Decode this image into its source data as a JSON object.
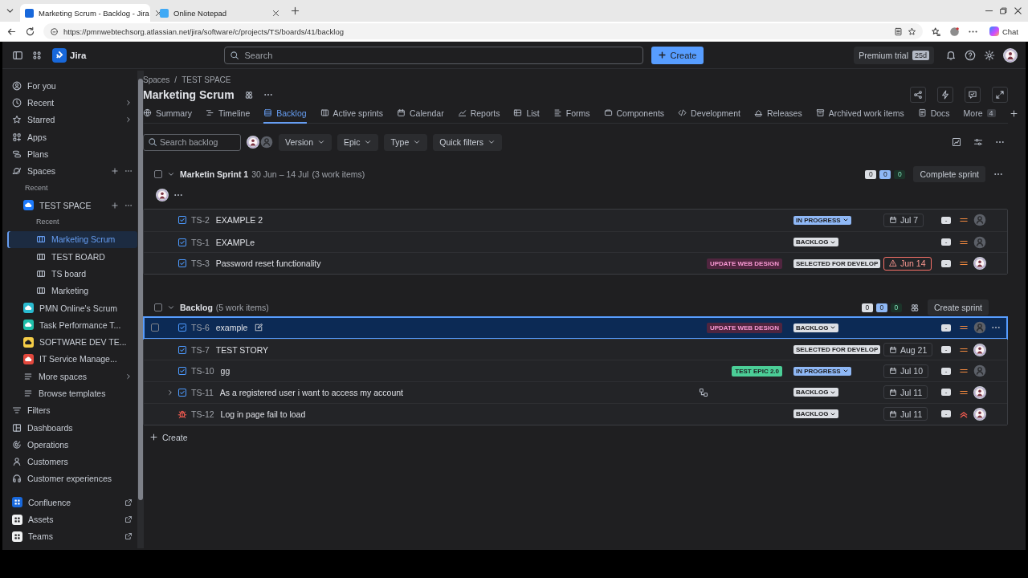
{
  "browser": {
    "tabs": [
      {
        "title": "Marketing Scrum - Backlog - Jira",
        "selected": true
      },
      {
        "title": "Online Notepad",
        "selected": false
      }
    ],
    "url": "https://pmnwebtechsorg.atlassian.net/jira/software/c/projects/TS/boards/41/backlog",
    "chat_label": "Chat"
  },
  "topbar": {
    "product": "Jira",
    "search_placeholder": "Search",
    "create_label": "Create",
    "trial_label": "Premium trial",
    "trial_badge": "25d"
  },
  "sidebar": {
    "items": [
      {
        "kind": "nav",
        "label": "For you"
      },
      {
        "kind": "nav",
        "label": "Recent",
        "chevron": true
      },
      {
        "kind": "nav",
        "label": "Starred",
        "chevron": true
      },
      {
        "kind": "nav",
        "label": "Apps"
      },
      {
        "kind": "nav",
        "label": "Plans"
      },
      {
        "kind": "nav",
        "label": "Spaces",
        "actions": true,
        "children": [
          {
            "kind": "heading",
            "label": "Recent"
          },
          {
            "kind": "space",
            "label": "TEST SPACE",
            "color": "#1d7afc",
            "actions": true,
            "heading": "Recent",
            "boards": [
              {
                "label": "Marketing Scrum",
                "selected": true
              },
              {
                "label": "TEST BOARD",
                "selected": false
              },
              {
                "label": "TS board",
                "selected": false
              },
              {
                "label": "Marketing",
                "selected": false
              }
            ]
          },
          {
            "kind": "space",
            "label": "PMN Online's Scrum",
            "color": "#2abbd0"
          },
          {
            "kind": "space",
            "label": "Task Performance T...",
            "color": "#1fbfaa"
          },
          {
            "kind": "space",
            "label": "SOFTWARE DEV TE...",
            "color": "#f5cd47"
          },
          {
            "kind": "space",
            "label": "IT Service Manage...",
            "color": "#e2483d"
          },
          {
            "kind": "nav",
            "label": "More spaces",
            "chevron": true
          },
          {
            "kind": "nav",
            "label": "Browse templates"
          }
        ]
      },
      {
        "kind": "nav",
        "label": "Filters"
      },
      {
        "kind": "nav",
        "label": "Dashboards"
      },
      {
        "kind": "nav",
        "label": "Operations"
      },
      {
        "kind": "nav",
        "label": "Customers"
      },
      {
        "kind": "nav",
        "label": "Customer experiences"
      },
      {
        "kind": "app",
        "label": "Confluence",
        "color": "#1868db"
      },
      {
        "kind": "app",
        "label": "Assets",
        "color": "#f0f1f2"
      },
      {
        "kind": "app",
        "label": "Teams",
        "color": "#f0f1f2"
      }
    ]
  },
  "breadcrumb": {
    "items": [
      "Spaces",
      "TEST SPACE"
    ],
    "separator": "/"
  },
  "title": "Marketing Scrum",
  "tabs": [
    {
      "label": "Summary",
      "selected": false
    },
    {
      "label": "Timeline",
      "selected": false
    },
    {
      "label": "Backlog",
      "selected": true
    },
    {
      "label": "Active sprints",
      "selected": false
    },
    {
      "label": "Calendar",
      "selected": false
    },
    {
      "label": "Reports",
      "selected": false
    },
    {
      "label": "List",
      "selected": false
    },
    {
      "label": "Forms",
      "selected": false
    },
    {
      "label": "Components",
      "selected": false
    },
    {
      "label": "Development",
      "selected": false
    },
    {
      "label": "Releases",
      "selected": false
    },
    {
      "label": "Archived work items",
      "selected": false
    },
    {
      "label": "Docs",
      "selected": false
    }
  ],
  "more_tab": {
    "label": "More",
    "badge": "4"
  },
  "filters": {
    "search_placeholder": "Search backlog",
    "avatars": [
      {
        "kind": "user"
      },
      {
        "kind": "unassigned"
      }
    ],
    "dropdowns": [
      "Version",
      "Epic",
      "Type",
      "Quick filters"
    ]
  },
  "sections": [
    {
      "kind": "sprint",
      "checked": false,
      "name": "Marketin Sprint 1",
      "dates": "30 Jun – 14 Jul",
      "count": "(3 work items)",
      "counts": [
        {
          "value": "0",
          "color": "#dcdfe4"
        },
        {
          "value": "0",
          "color": "#8fb8f6"
        },
        {
          "value": "0",
          "color": "#1c3329"
        }
      ],
      "action": "Complete sprint",
      "rows": [
        {
          "kind": "story",
          "key": "TS-2",
          "summary": "EXAMPLE 2",
          "status": {
            "label": "IN PROGRESS",
            "color": "#8fb8f6",
            "dropdown": true
          },
          "date": {
            "label": "Jul 7",
            "overdue": false
          },
          "estimate": "-",
          "priority": {
            "kind": "medium"
          },
          "assignee": {
            "kind": "unassigned"
          },
          "selected": false
        },
        {
          "kind": "story",
          "key": "TS-1",
          "summary": "EXAMPLe",
          "status": {
            "label": "BACKLOG",
            "color": "#dcdfe4",
            "dropdown": true
          },
          "estimate": "-",
          "priority": {
            "kind": "medium"
          },
          "assignee": {
            "kind": "unassigned"
          },
          "selected": false
        },
        {
          "kind": "story",
          "key": "TS-3",
          "summary": "Password reset functionality",
          "epic": {
            "label": "UPDATE WEB DESIGN",
            "color": "#50253f"
          },
          "status": {
            "label": "SELECTED FOR DEVELOP",
            "color": "#dcdfe4",
            "dropdown": false
          },
          "date": {
            "label": "Jun 14",
            "overdue": true
          },
          "estimate": "-",
          "priority": {
            "kind": "medium"
          },
          "assignee": {
            "kind": "user"
          },
          "selected": false
        }
      ]
    },
    {
      "kind": "backlog",
      "checked": false,
      "name": "Backlog",
      "count": "(5 work items)",
      "counts": [
        {
          "value": "0",
          "color": "#dcdfe4"
        },
        {
          "value": "0",
          "color": "#8fb8f6"
        },
        {
          "value": "0",
          "color": "#1c3329"
        }
      ],
      "action": "Create sprint",
      "create": "Create",
      "rows": [
        {
          "kind": "story",
          "key": "TS-6",
          "summary": "example",
          "epic": {
            "label": "UPDATE WEB DESIGN",
            "color": "#50253f"
          },
          "status": {
            "label": "BACKLOG",
            "color": "#dcdfe4",
            "dropdown": true
          },
          "estimate": "-",
          "priority": {
            "kind": "medium"
          },
          "assignee": {
            "kind": "unassigned"
          },
          "selected": true
        },
        {
          "kind": "story",
          "key": "TS-7",
          "summary": "TEST STORY",
          "status": {
            "label": "SELECTED FOR DEVELOP",
            "color": "#dcdfe4",
            "dropdown": false
          },
          "date": {
            "label": "Aug 21",
            "overdue": false
          },
          "estimate": "-",
          "priority": {
            "kind": "medium"
          },
          "assignee": {
            "kind": "user"
          },
          "selected": false
        },
        {
          "kind": "story",
          "key": "TS-10",
          "summary": "gg",
          "epic": {
            "label": "TEST EPIC 2.0",
            "color": "#4bce97"
          },
          "status": {
            "label": "IN PROGRESS",
            "color": "#8fb8f6",
            "dropdown": true
          },
          "date": {
            "label": "Jul 10",
            "overdue": false
          },
          "estimate": "-",
          "priority": {
            "kind": "medium"
          },
          "assignee": {
            "kind": "unassigned"
          },
          "selected": false
        },
        {
          "kind": "story",
          "key": "TS-11",
          "summary": "As a registered user i want to access my account",
          "expandable": true,
          "status": {
            "label": "BACKLOG",
            "color": "#dcdfe4",
            "dropdown": true
          },
          "date": {
            "label": "Jul 11",
            "overdue": false
          },
          "estimate": "-",
          "priority": {
            "kind": "medium"
          },
          "assignee": {
            "kind": "user"
          },
          "selected": false
        },
        {
          "kind": "bug",
          "key": "TS-12",
          "summary": "Log in page fail to load",
          "status": {
            "label": "BACKLOG",
            "color": "#dcdfe4",
            "dropdown": true
          },
          "date": {
            "label": "Jul 11",
            "overdue": false
          },
          "estimate": "-",
          "priority": {
            "kind": "high"
          },
          "assignee": {
            "kind": "user"
          },
          "selected": false
        }
      ]
    }
  ]
}
